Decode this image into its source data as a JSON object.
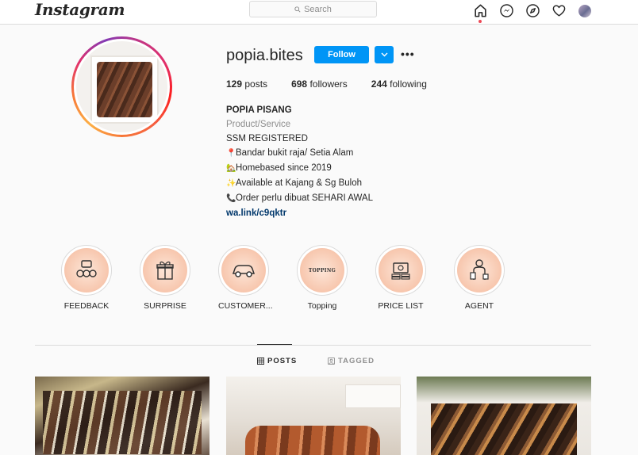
{
  "nav": {
    "logo": "Instagram",
    "search_placeholder": "Search",
    "icons": [
      "home-icon",
      "messenger-icon",
      "explore-icon",
      "heart-icon",
      "avatar"
    ]
  },
  "profile": {
    "username": "popia.bites",
    "follow_label": "Follow",
    "more_label": "•••",
    "stats": {
      "posts": "129",
      "posts_label": "posts",
      "followers": "698",
      "followers_label": "followers",
      "following": "244",
      "following_label": "following"
    },
    "bio": {
      "name": "POPIA PISANG",
      "category": "Product/Service",
      "lines": [
        {
          "emoji": "📍",
          "text": "SSM REGISTERED"
        },
        {
          "emoji": "📍",
          "text": "Bandar bukit raja/ Setia Alam"
        },
        {
          "emoji": "🏡",
          "text": "Homebased since 2019"
        },
        {
          "emoji": "✨",
          "text": "Available at Kajang & Sg Buloh"
        },
        {
          "emoji": "📞",
          "text": "Order perlu dibuat SEHARI AWAL"
        }
      ],
      "link": "wa.link/c9qktr"
    }
  },
  "highlights": [
    {
      "label": "FEEDBACK",
      "icon": "feedback-icon"
    },
    {
      "label": "SURPRISE",
      "icon": "gift-icon"
    },
    {
      "label": "CUSTOMER...",
      "icon": "car-icon"
    },
    {
      "label": "Topping",
      "icon": "topping-icon",
      "badge": "TOPPING"
    },
    {
      "label": "PRICE LIST",
      "icon": "money-icon"
    },
    {
      "label": "AGENT",
      "icon": "agent-icon"
    }
  ],
  "tabs": {
    "posts": "POSTS",
    "tagged": "TAGGED"
  },
  "colors": {
    "primary_blue": "#0095f6",
    "link_blue": "#00376b",
    "highlight_peach": "#f7c6ad"
  }
}
